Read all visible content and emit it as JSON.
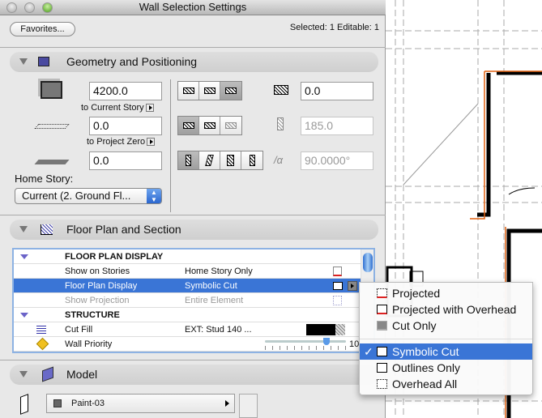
{
  "window": {
    "title": "Wall Selection Settings"
  },
  "header": {
    "favorites_label": "Favorites...",
    "selection_info": "Selected: 1 Editable: 1"
  },
  "geometry": {
    "section_title": "Geometry and Positioning",
    "height_value": "4200.0",
    "top_link_label": "to Current Story",
    "base_offset_value": "0.0",
    "base_link_label": "to Project Zero",
    "bottom_offset_value": "0.0",
    "home_story_label": "Home Story:",
    "home_story_value": "Current (2. Ground Fl...",
    "ref_line_offset_value": "0.0",
    "thickness_value": "185.0",
    "angle_value": "90.0000°"
  },
  "floor_plan": {
    "section_title": "Floor Plan and Section",
    "rows": [
      {
        "name": "FLOOR PLAN DISPLAY",
        "value": "",
        "type": "group"
      },
      {
        "name": "Show on Stories",
        "value": "Home Story Only",
        "type": "item"
      },
      {
        "name": "Floor Plan Display",
        "value": "Symbolic Cut",
        "type": "selected"
      },
      {
        "name": "Show Projection",
        "value": "Entire Element",
        "type": "disabled"
      },
      {
        "name": "STRUCTURE",
        "value": "",
        "type": "group"
      },
      {
        "name": "Cut Fill",
        "value": "EXT: Stud 140 ...",
        "type": "item"
      },
      {
        "name": "Wall Priority",
        "value": "",
        "type": "item"
      }
    ],
    "wall_priority_value": "10",
    "wall_priority_fraction": 0.5
  },
  "model": {
    "section_title": "Model",
    "surface_value": "Paint-03"
  },
  "dropdown": {
    "items": [
      "Projected",
      "Projected with Overhead",
      "Cut Only"
    ],
    "items2": [
      "Symbolic Cut",
      "Outlines Only",
      "Overhead All"
    ],
    "selected": "Symbolic Cut",
    "check": "✓"
  }
}
